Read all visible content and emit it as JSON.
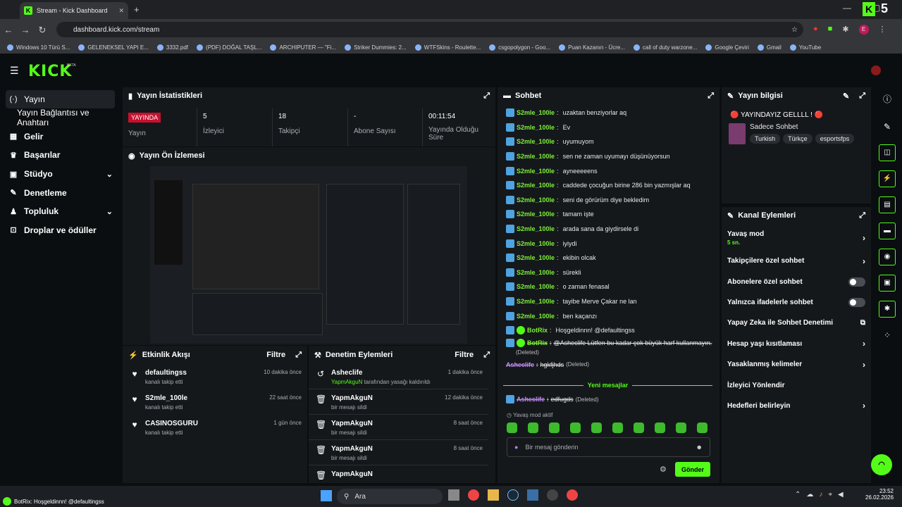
{
  "browser": {
    "tab_title": "Stream - Kick Dashboard",
    "url": "dashboard.kick.com/stream",
    "bookmarks": [
      "Windows 10 Türü S...",
      "GELENEKSEL YAPI E...",
      "3332.pdf",
      "(PDF) DOĞAL TAŞL...",
      "ARCHIPUTER — \"Fi...",
      "Striker Dummies: 2...",
      "WTFSkins - Roulette...",
      "csgopolygon - Goo...",
      "Puan Kazanın - Ücre...",
      "call of duty warzone...",
      "Google Çeviri",
      "Gmail",
      "YouTube"
    ],
    "profile": "E"
  },
  "brand": {
    "logo": "KICK",
    "beta": "BETA"
  },
  "sidebar": [
    {
      "label": "Yayın",
      "icon": "broadcast-icon"
    },
    {
      "label": "Yayın Bağlantısı ve Anahtarı"
    },
    {
      "label": "Gelir",
      "icon": "chart-icon"
    },
    {
      "label": "Başarılar",
      "icon": "trophy-icon"
    },
    {
      "label": "Stüdyo",
      "icon": "grid-icon"
    },
    {
      "label": "Denetleme",
      "icon": "wrench-icon"
    },
    {
      "label": "Topluluk",
      "icon": "people-icon"
    },
    {
      "label": "Droplar ve ödüller",
      "icon": "gift-icon"
    }
  ],
  "stats": {
    "title": "Yayın İstatistikleri",
    "live_badge": "YAYINDA",
    "items": [
      {
        "value": "",
        "label": "Yayın"
      },
      {
        "value": "5",
        "label": "İzleyici"
      },
      {
        "value": "18",
        "label": "Takipçi"
      },
      {
        "value": "-",
        "label": "Abone Sayısı"
      },
      {
        "value": "00:11:54",
        "label": "Yayında Olduğu Süre"
      }
    ]
  },
  "preview": {
    "title": "Yayın Ön İzlemesi"
  },
  "activity": {
    "title": "Etkinlik Akışı",
    "filter": "Filtre",
    "rows": [
      {
        "name": "defaultingss",
        "sub": "kanalı takip etti",
        "time": "10 dakika önce"
      },
      {
        "name": "S2mle_100le",
        "sub": "kanalı takip etti",
        "time": "22 saat önce"
      },
      {
        "name": "CASINOSGURU",
        "sub": "kanalı takip etti",
        "time": "1 gün önce"
      }
    ]
  },
  "moderation": {
    "title": "Denetim Eylemleri",
    "filter": "Filtre",
    "rows": [
      {
        "name": "Asheclife",
        "by": "YapmAkguN",
        "sub": " tarafından yasağı kaldırıldı",
        "time": "1 dakika önce"
      },
      {
        "name": "YapmAkguN",
        "sub": "bir mesajı sildi",
        "time": "12 dakika önce"
      },
      {
        "name": "YapmAkguN",
        "sub": "bir mesajı sildi",
        "time": "8 saat önce"
      },
      {
        "name": "YapmAkguN",
        "sub": "bir mesajı sildi",
        "time": "8 saat önce"
      },
      {
        "name": "YapmAkguN",
        "sub": "",
        "time": ""
      }
    ]
  },
  "chat": {
    "title": "Sohbet",
    "messages": [
      {
        "user": "S2mle_100le",
        "text": "uzaktan benziyorlar aq"
      },
      {
        "user": "S2mle_100le",
        "text": "Ev"
      },
      {
        "user": "S2mle_100le",
        "text": "uyumuyom"
      },
      {
        "user": "S2mle_100le",
        "text": "sen ne zaman uyumayı düşünüyorsun"
      },
      {
        "user": "S2mle_100le",
        "text": "ayneeeeens"
      },
      {
        "user": "S2mle_100le",
        "text": "caddede çocuğun birine 286 bin yazmışlar aq"
      },
      {
        "user": "S2mle_100le",
        "text": "seni de görürüm diye bekledim"
      },
      {
        "user": "S2mle_100le",
        "text": "tamam işte"
      },
      {
        "user": "S2mle_100le",
        "text": "arada sana da giydirsele di"
      },
      {
        "user": "S2mle_100le",
        "text": "iyiydi"
      },
      {
        "user": "S2mle_100le",
        "text": "ekibin olcak"
      },
      {
        "user": "S2mle_100le",
        "text": "sürekli"
      },
      {
        "user": "S2mle_100le",
        "text": "o zaman fenasal"
      },
      {
        "user": "S2mle_100le",
        "text": "tayibe Merve Çakar ne lan"
      },
      {
        "user": "S2mle_100le",
        "text": "ben kaçanzı"
      },
      {
        "user": "BotRix",
        "text": "Hoşgeldinnn! @defaultingss"
      }
    ],
    "deleted1_text": "@Asheclife Lütfen bu kadar çok büyük harf kullanmayın.",
    "deleted_tag": "(Deleted)",
    "deleted2_user": "Asheclife",
    "deleted2_text": "hgkfjhds",
    "new_messages": "Yeni mesajlar",
    "deleted3_user": "Asheclife",
    "deleted3_text": "edfugds",
    "slow_mode": "Yavaş mod aktif",
    "placeholder": "Bir mesaj gönderin",
    "send": "Gönder"
  },
  "info": {
    "title": "Yayın bilgisi",
    "stream_title": "🔴 YAYINDAYIZ GELLLL ! 🔴",
    "category": "Sadece Sohbet",
    "tags": [
      "Turkish",
      "Türkçe",
      "esportsfps"
    ]
  },
  "actions": {
    "title": "Kanal Eylemleri",
    "slow_label": "Yavaş mod",
    "slow_value": "5 sn.",
    "rows": [
      "Takipçilere özel sohbet",
      "Abonelere özel sohbet",
      "Yalnızca ifadelerle sohbet",
      "Yapay Zeka ile Sohbet Denetimi",
      "Hesap yaşı kısıtlaması",
      "Yasaklanmış kelimeler",
      "İzleyici Yönlendir",
      "Hedefleri belirleyin"
    ]
  },
  "taskbar": {
    "search": "Ara",
    "time": "23:52",
    "date": "26.02.2026",
    "toast": "BotRix: Hoşgeldinnn! @defaultingss"
  }
}
